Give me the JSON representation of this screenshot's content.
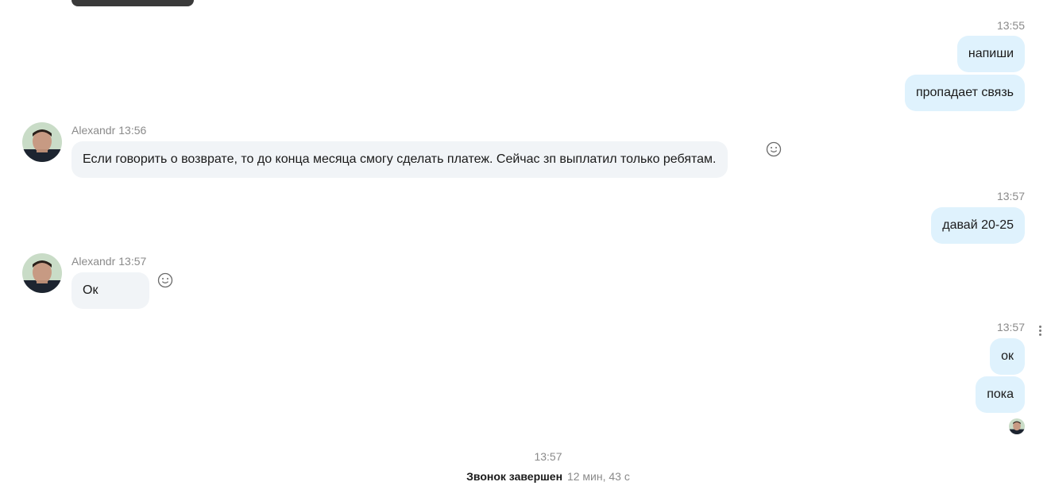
{
  "messages": {
    "group1": {
      "time": "13:55",
      "bubbles": [
        "напиши",
        "пропадает связь"
      ]
    },
    "in1": {
      "sender": "Alexandr",
      "time": "13:56",
      "text": "Если говорить о возврате, то до конца месяца смогу сделать платеж. Сейчас зп выплатил только ребятам."
    },
    "group2": {
      "time": "13:57",
      "bubbles": [
        "давай 20-25"
      ]
    },
    "in2": {
      "sender": "Alexandr",
      "time": "13:57",
      "text": "Ок"
    },
    "group3": {
      "time": "13:57",
      "bubbles": [
        "ок",
        "пока"
      ]
    }
  },
  "call": {
    "time": "13:57",
    "status": "Звонок завершен",
    "duration": "12 мин, 43 с"
  },
  "icons": {
    "reaction": "smiley-icon",
    "more": "more-vertical-icon",
    "avatar": "user-avatar"
  },
  "colors": {
    "outgoing_bubble": "#dff2fd",
    "incoming_bubble": "#f1f4f7",
    "meta_text": "#8a8a8a"
  }
}
